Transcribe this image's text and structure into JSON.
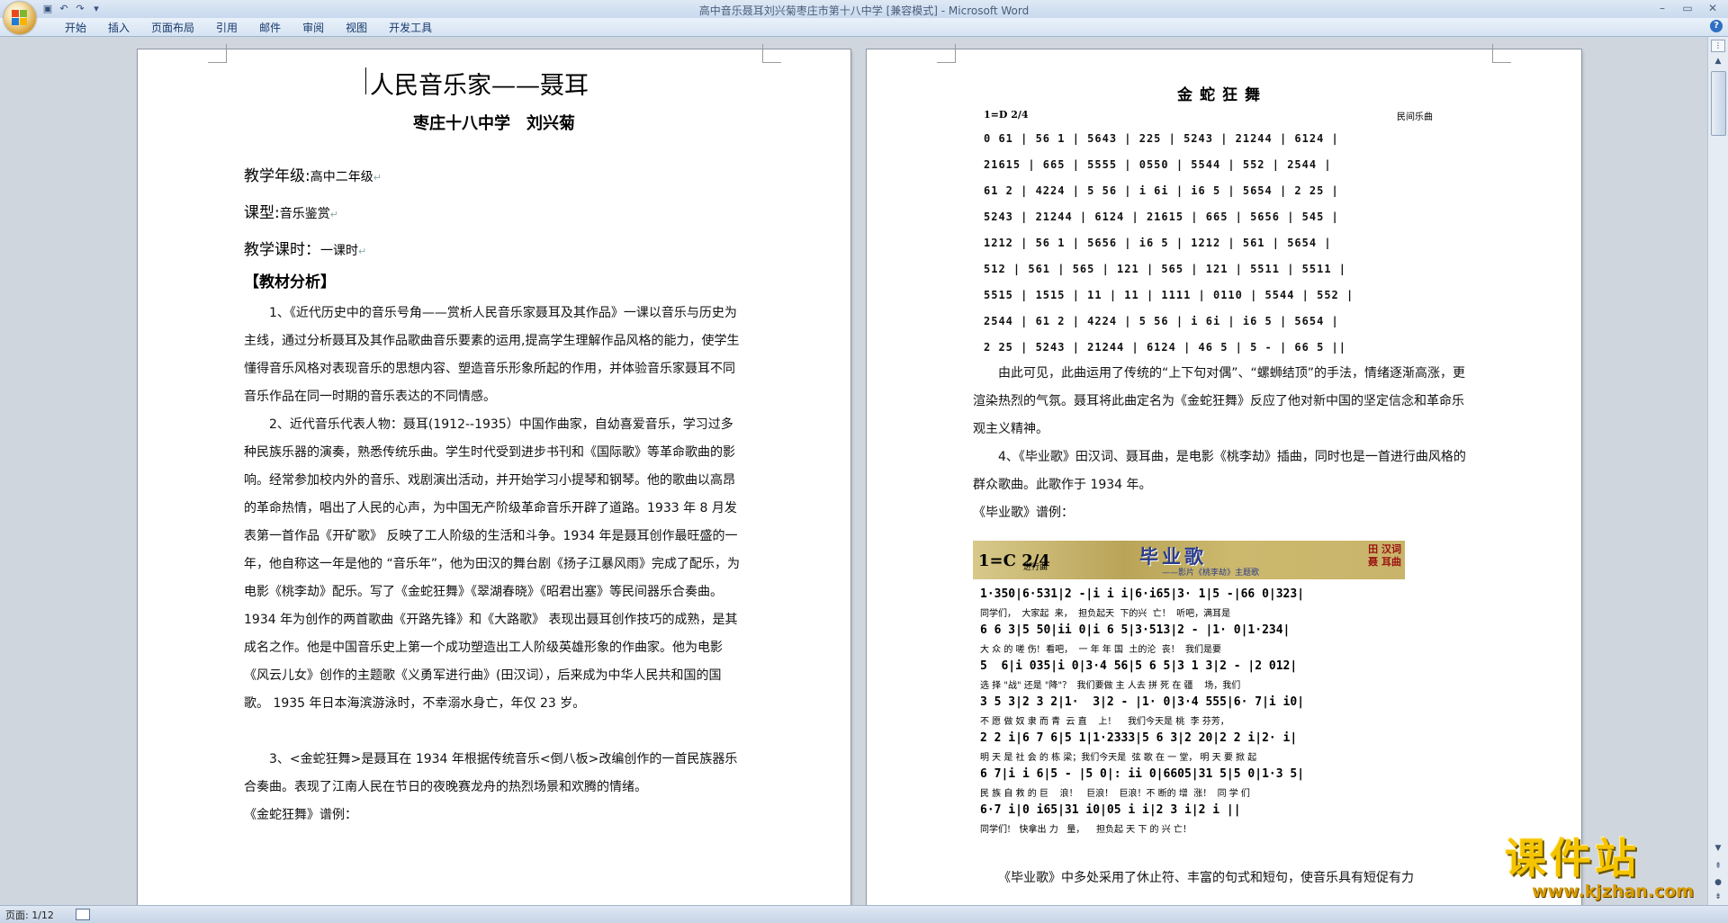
{
  "window": {
    "title": "高中音乐聂耳刘兴菊枣庄市第十八中学 [兼容模式] - Microsoft Word",
    "quick_access": [
      "save-icon",
      "undo-icon",
      "redo-icon",
      "customize-icon"
    ],
    "controls": [
      "minimize",
      "maximize",
      "close"
    ]
  },
  "ribbon": {
    "tabs": [
      "开始",
      "插入",
      "页面布局",
      "引用",
      "邮件",
      "审阅",
      "视图",
      "开发工具"
    ]
  },
  "page1": {
    "title": "人民音乐家——聂耳",
    "author": "枣庄十八中学　刘兴菊",
    "fields": [
      {
        "label": "教学年级",
        "sep": ":",
        "value": "高中二年级"
      },
      {
        "label": "课型",
        "sep": ":",
        "value": "音乐鉴赏"
      },
      {
        "label": "教学课时",
        "sep": "：",
        "value": "一课时"
      }
    ],
    "section": "【教材分析】",
    "paragraphs": [
      "1、《近代历史中的音乐号角——赏析人民音乐家聂耳及其作品》一课以音乐与历史为主线，通过分析聂耳及其作品歌曲音乐要素的运用,提高学生理解作品风格的能力，使学生懂得音乐风格对表现音乐的思想内容、塑造音乐形象所起的作用，并体验音乐家聂耳不同音乐作品在同一时期的音乐表达的不同情感。",
      "2、近代音乐代表人物：聂耳(1912--1935）中国作曲家，自幼喜爱音乐，学习过多种民族乐器的演奏，熟悉传统乐曲。学生时代受到进步书刊和《国际歌》等革命歌曲的影响。经常参加校内外的音乐、戏剧演出活动，并开始学习小提琴和钢琴。他的歌曲以高昂的革命热情，唱出了人民的心声，为中国无产阶级革命音乐开辟了道路。1933 年 8 月发表第一首作品《开矿歌》 反映了工人阶级的生活和斗争。1934 年是聂耳创作最旺盛的一年，他自称这一年是他的 “音乐年”，他为田汉的舞台剧《扬子江暴风雨》完成了配乐，为电影《桃李劫》配乐。写了《金蛇狂舞》《翠湖春晓》《昭君出塞》等民间器乐合奏曲。1934 年为创作的两首歌曲《开路先锋》和《大路歌》 表现出聂耳创作技巧的成熟，是其成名之作。他是中国音乐史上第一个成功塑造出工人阶级英雄形象的作曲家。他为电影《风云儿女》创作的主题歌《义勇军进行曲》(田汉词），后来成为中华人民共和国的国歌。 1935 年日本海滨游泳时，不幸溺水身亡，年仅 23 岁。",
      "3、<金蛇狂舞>是聂耳在 1934 年根据传统音乐<倒八板>改编创作的一首民族器乐合奏曲。表现了江南人民在节日的夜晚赛龙舟的热烈场景和欢腾的情绪。"
    ],
    "score_ref": "《金蛇狂舞》谱例："
  },
  "page2": {
    "score1": {
      "title": "金蛇狂舞",
      "key": "1=D 2/4",
      "note": "民间乐曲",
      "lines": [
        "0 61 | 56 1 | 5643 | 225 | 5243 | 21244 | 6124 |",
        "21615 | 665 | 5555 | 0550 | 5544 | 552 | 2544 |",
        "61 2 | 4224 | 5 56 | i 6i | i6 5 | 5654 | 2 25 |",
        "5243 | 21244 | 6124 | 21615 | 665 | 5656 | 545 |",
        "1212 | 56 1 | 5656 | i6 5 | 1212 | 561 | 5654 |",
        "512 | 561 | 565 | 121 | 565 | 121 | 5511 | 5511 |",
        "5515 | 1515 | 11 | 11 | 1111 | 0110 | 5544 | 552 |",
        "2544 | 61 2 | 4224 | 5 56 | i 6i | i6 5 | 5654 |",
        "2 25 | 5243 | 21244 | 6124 | 46 5 | 5 - | 66 5 ||"
      ]
    },
    "text1": "由此可见，此曲运用了传统的“上下句对偶”、“螺蛳结顶”的手法，情绪逐渐高涨，更渲染热烈的气氛。聂耳将此曲定名为《金蛇狂舞》反应了他对新中国的坚定信念和革命乐观主义精神。",
    "text2": "4、《毕业歌》田汉词、聂耳曲，是电影《桃李劫》插曲，同时也是一首进行曲风格的群众歌曲。此歌作于 1934 年。",
    "score_ref": "《毕业歌》谱例：",
    "score2": {
      "key": "1=C 2/4",
      "tempo": "进行曲",
      "title": "毕业歌",
      "subtitle": "——影片《桃李劫》主题歌",
      "credit_lyric": "田 汉词",
      "credit_music": "聂 耳曲",
      "rows": [
        {
          "notes": "1·350|6·531|2 -|i i i|6·i65|3· 1|5 -|66 0|323|",
          "lyric": "同学们，  大家起  来，  担负起天  下的兴  亡！  听吧，满耳是"
        },
        {
          "notes": "6 6 3|5 50|ii 0|i 6 5|3·513|2 - |1· 0|1·234|",
          "lyric": "大 众 的 嗟 伤!  看吧，  一 年 年 国  土的沦  丧！  我们是要"
        },
        {
          "notes": "5  6|i 035|i 0|3·4 56|5 6 5|3 1 3|2 - |2 012|",
          "lyric": "选 择 \"战\" 还是 \"降\"？  我们要做 主 人去 拼 死 在 疆    场，我们"
        },
        {
          "notes": "3 5 3|2 3 2|1·  3|2 - |1· 0|3·4 555|6· 7|i i0|",
          "lyric": "不 愿 做 奴 隶 而 青  云 直    上！    我们今天是 桃  李 芬芳，"
        },
        {
          "notes": "2 2 i|6 7 6|5 1|1·2333|5 6 3|2 20|2 2 i|2· i|",
          "lyric": "明 天 是 社 会 的 栋 梁；我们今天是  弦 歌 在 一 堂， 明 天 要 掀 起"
        },
        {
          "notes": "6 7|i i 6|5 - |5 0|: ii 0|6605|31 5|5 0|1·3 5|",
          "lyric": "民 族 自 救 的 巨    浪！   巨浪！  巨浪！不 断的 增  涨！  同 学 们"
        },
        {
          "notes": "6·7 i|0 i65|31 i0|05 i i|2 3 i|2 i ||",
          "lyric": "同学们!   快拿出 力   量，    担负起 天 下 的 兴 亡！"
        }
      ]
    },
    "text3": "《毕业歌》中多处采用了休止符、丰富的句式和短句，使音乐具有短促有力"
  },
  "status": {
    "page_info": "页面: 1/12"
  },
  "watermark": {
    "name": "课件站",
    "url": "www.kjzhan.com"
  }
}
